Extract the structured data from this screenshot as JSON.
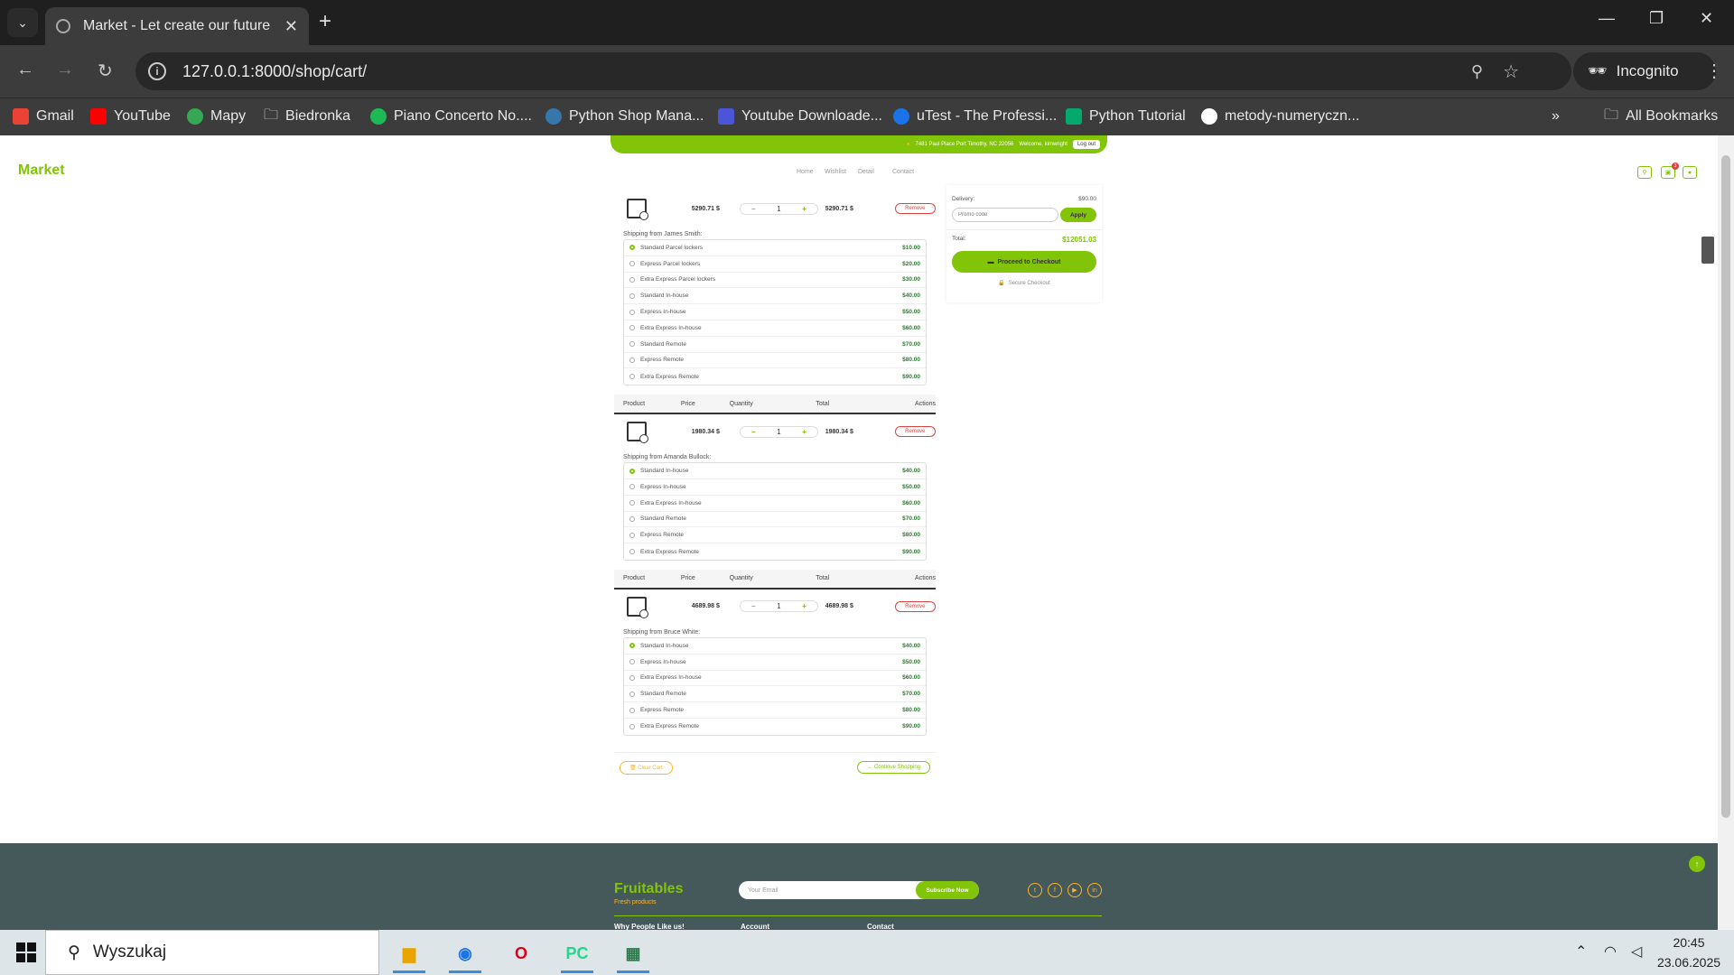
{
  "browser": {
    "tab_title": "Market - Let create our future",
    "url": "127.0.0.1:8000/shop/cart/",
    "profile_label": "Incognito",
    "bookmarks": [
      "Gmail",
      "YouTube",
      "Mapy",
      "Biedronka",
      "Piano Concerto No....",
      "Python Shop Mana...",
      "Youtube Downloade...",
      "uTest - The Professi...",
      "Python Tutorial",
      "metody-numeryczn..."
    ],
    "all_bookmarks": "All Bookmarks"
  },
  "site": {
    "brand": "Market",
    "address": "7481 Paul Place Port Timothy, NC 22056",
    "welcome": "Welcome, kimwright",
    "logout": "Log out",
    "cart_badge": "3",
    "menu": [
      "Home",
      "Wishlist",
      "Detail",
      "Contact"
    ]
  },
  "cart": {
    "headers": [
      "Product",
      "Price",
      "Quantity",
      "Total",
      "Actions"
    ],
    "remove_label": "Remove",
    "items": [
      {
        "price": "5290.71 $",
        "qty": "1",
        "total": "5290.71 $",
        "shipping_from": "Shipping from James Smith:",
        "options": [
          {
            "label": "Standard Parcel lockers",
            "price": "$10.00",
            "selected": true
          },
          {
            "label": "Express Parcel lockers",
            "price": "$20.00",
            "selected": false
          },
          {
            "label": "Extra Express Parcel lockers",
            "price": "$30.00",
            "selected": false
          },
          {
            "label": "Standard In-house",
            "price": "$40.00",
            "selected": false
          },
          {
            "label": "Express In-house",
            "price": "$50.00",
            "selected": false
          },
          {
            "label": "Extra Express In-house",
            "price": "$60.00",
            "selected": false
          },
          {
            "label": "Standard Remote",
            "price": "$70.00",
            "selected": false
          },
          {
            "label": "Express Remote",
            "price": "$80.00",
            "selected": false
          },
          {
            "label": "Extra Express Remote",
            "price": "$90.00",
            "selected": false
          }
        ]
      },
      {
        "price": "1980.34 $",
        "qty": "1",
        "total": "1980.34 $",
        "shipping_from": "Shipping from Amanda Bullock:",
        "options": [
          {
            "label": "Standard In-house",
            "price": "$40.00",
            "selected": true
          },
          {
            "label": "Express In-house",
            "price": "$50.00",
            "selected": false
          },
          {
            "label": "Extra Express In-house",
            "price": "$60.00",
            "selected": false
          },
          {
            "label": "Standard Remote",
            "price": "$70.00",
            "selected": false
          },
          {
            "label": "Express Remote",
            "price": "$80.00",
            "selected": false
          },
          {
            "label": "Extra Express Remote",
            "price": "$90.00",
            "selected": false
          }
        ]
      },
      {
        "price": "4689.98 $",
        "qty": "1",
        "total": "4689.98 $",
        "shipping_from": "Shipping from Bruce White:",
        "options": [
          {
            "label": "Standard In-house",
            "price": "$40.00",
            "selected": true
          },
          {
            "label": "Express In-house",
            "price": "$50.00",
            "selected": false
          },
          {
            "label": "Extra Express In-house",
            "price": "$60.00",
            "selected": false
          },
          {
            "label": "Standard Remote",
            "price": "$70.00",
            "selected": false
          },
          {
            "label": "Express Remote",
            "price": "$80.00",
            "selected": false
          },
          {
            "label": "Extra Express Remote",
            "price": "$90.00",
            "selected": false
          }
        ]
      }
    ],
    "clear_label": "Clear Cart",
    "continue_label": "Continue Shopping"
  },
  "summary": {
    "delivery_label": "Delivery:",
    "delivery_value": "$90.00",
    "promo_placeholder": "Promo code",
    "apply_label": "Apply",
    "total_label": "Total:",
    "total_value": "$12051.03",
    "checkout_label": "Proceed to Checkout",
    "secure_label": "Secure Checkout"
  },
  "footer": {
    "brand": "Fruitables",
    "tagline": "Fresh products",
    "email_placeholder": "Your Email",
    "subscribe_label": "Subscribe Now",
    "col_titles": [
      "Why People Like us!",
      "Account",
      "Contact"
    ]
  },
  "taskbar": {
    "search_placeholder": "Wyszukaj",
    "time": "20:45",
    "date": "23.06.2025"
  }
}
